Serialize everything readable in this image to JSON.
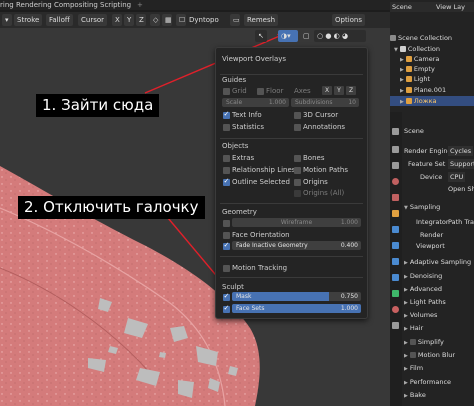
{
  "workspace_tabs": [
    "ring",
    "Rendering",
    "Compositing",
    "Scripting"
  ],
  "viewport_header": {
    "stroke": "Stroke",
    "falloff": "Falloff",
    "cursor": "Cursor",
    "dyntopo": "Dyntopo",
    "remesh": "Remesh",
    "options": "Options"
  },
  "overlay_panel": {
    "title": "Viewport Overlays",
    "guides": {
      "heading": "Guides",
      "grid": "Grid",
      "floor": "Floor",
      "axes": "Axes",
      "axis_x": "X",
      "axis_y": "Y",
      "axis_z": "Z",
      "scale": "Scale",
      "scale_value": "1.000",
      "subdivisions": "Subdivisions",
      "subdivisions_value": "10",
      "text_info": "Text Info",
      "cursor_3d": "3D Cursor",
      "statistics": "Statistics",
      "annotations": "Annotations"
    },
    "objects": {
      "heading": "Objects",
      "extras": "Extras",
      "bones": "Bones",
      "relationship_lines": "Relationship Lines",
      "motion_paths": "Motion Paths",
      "outline_selected": "Outline Selected",
      "origins": "Origins",
      "origins_all": "Origins (All)"
    },
    "geometry": {
      "heading": "Geometry",
      "wireframe": "Wireframe",
      "wireframe_value": "1.000",
      "face_orientation": "Face Orientation",
      "fade_inactive": "Fade Inactive Geometry",
      "fade_value": "0.400",
      "motion_tracking": "Motion Tracking"
    },
    "sculpt": {
      "heading": "Sculpt",
      "mask": "Mask",
      "mask_value": "0.750",
      "mask_fraction": 0.75,
      "face_sets": "Face Sets",
      "face_sets_value": "1.000",
      "face_sets_fraction": 1.0
    }
  },
  "annotations": {
    "step1": "1. Зайти сюда",
    "step2": "2. Отключить галочку"
  },
  "outliner": {
    "top_scene": "Scene",
    "top_view_layer": "View Lay",
    "scene_collection": "Scene Collection",
    "items": [
      "Collection",
      "Camera",
      "Empty",
      "Light",
      "Plane.001",
      "Ложка"
    ]
  },
  "properties": {
    "scene": "Scene",
    "render_engine_label": "Render Engine",
    "render_engine": "Cycles",
    "feature_set_label": "Feature Set",
    "feature_set": "Supporte",
    "device_label": "Device",
    "device": "CPU",
    "open_shading": "Open Sh",
    "sampling": "Sampling",
    "integrator_label": "Integrator",
    "integrator": "Path Trac",
    "render": "Render",
    "viewport": "Viewport",
    "adaptive_sampling": "Adaptive Sampling",
    "denoising": "Denoising",
    "advanced": "Advanced",
    "light_paths": "Light Paths",
    "volumes": "Volumes",
    "hair": "Hair",
    "simplify": "Simplify",
    "motion_blur": "Motion Blur",
    "film": "Film",
    "performance": "Performance",
    "bake": "Bake"
  },
  "colors": {
    "accent": "#4772b3",
    "mesh": "#d98383",
    "arrow": "#e0202a"
  }
}
